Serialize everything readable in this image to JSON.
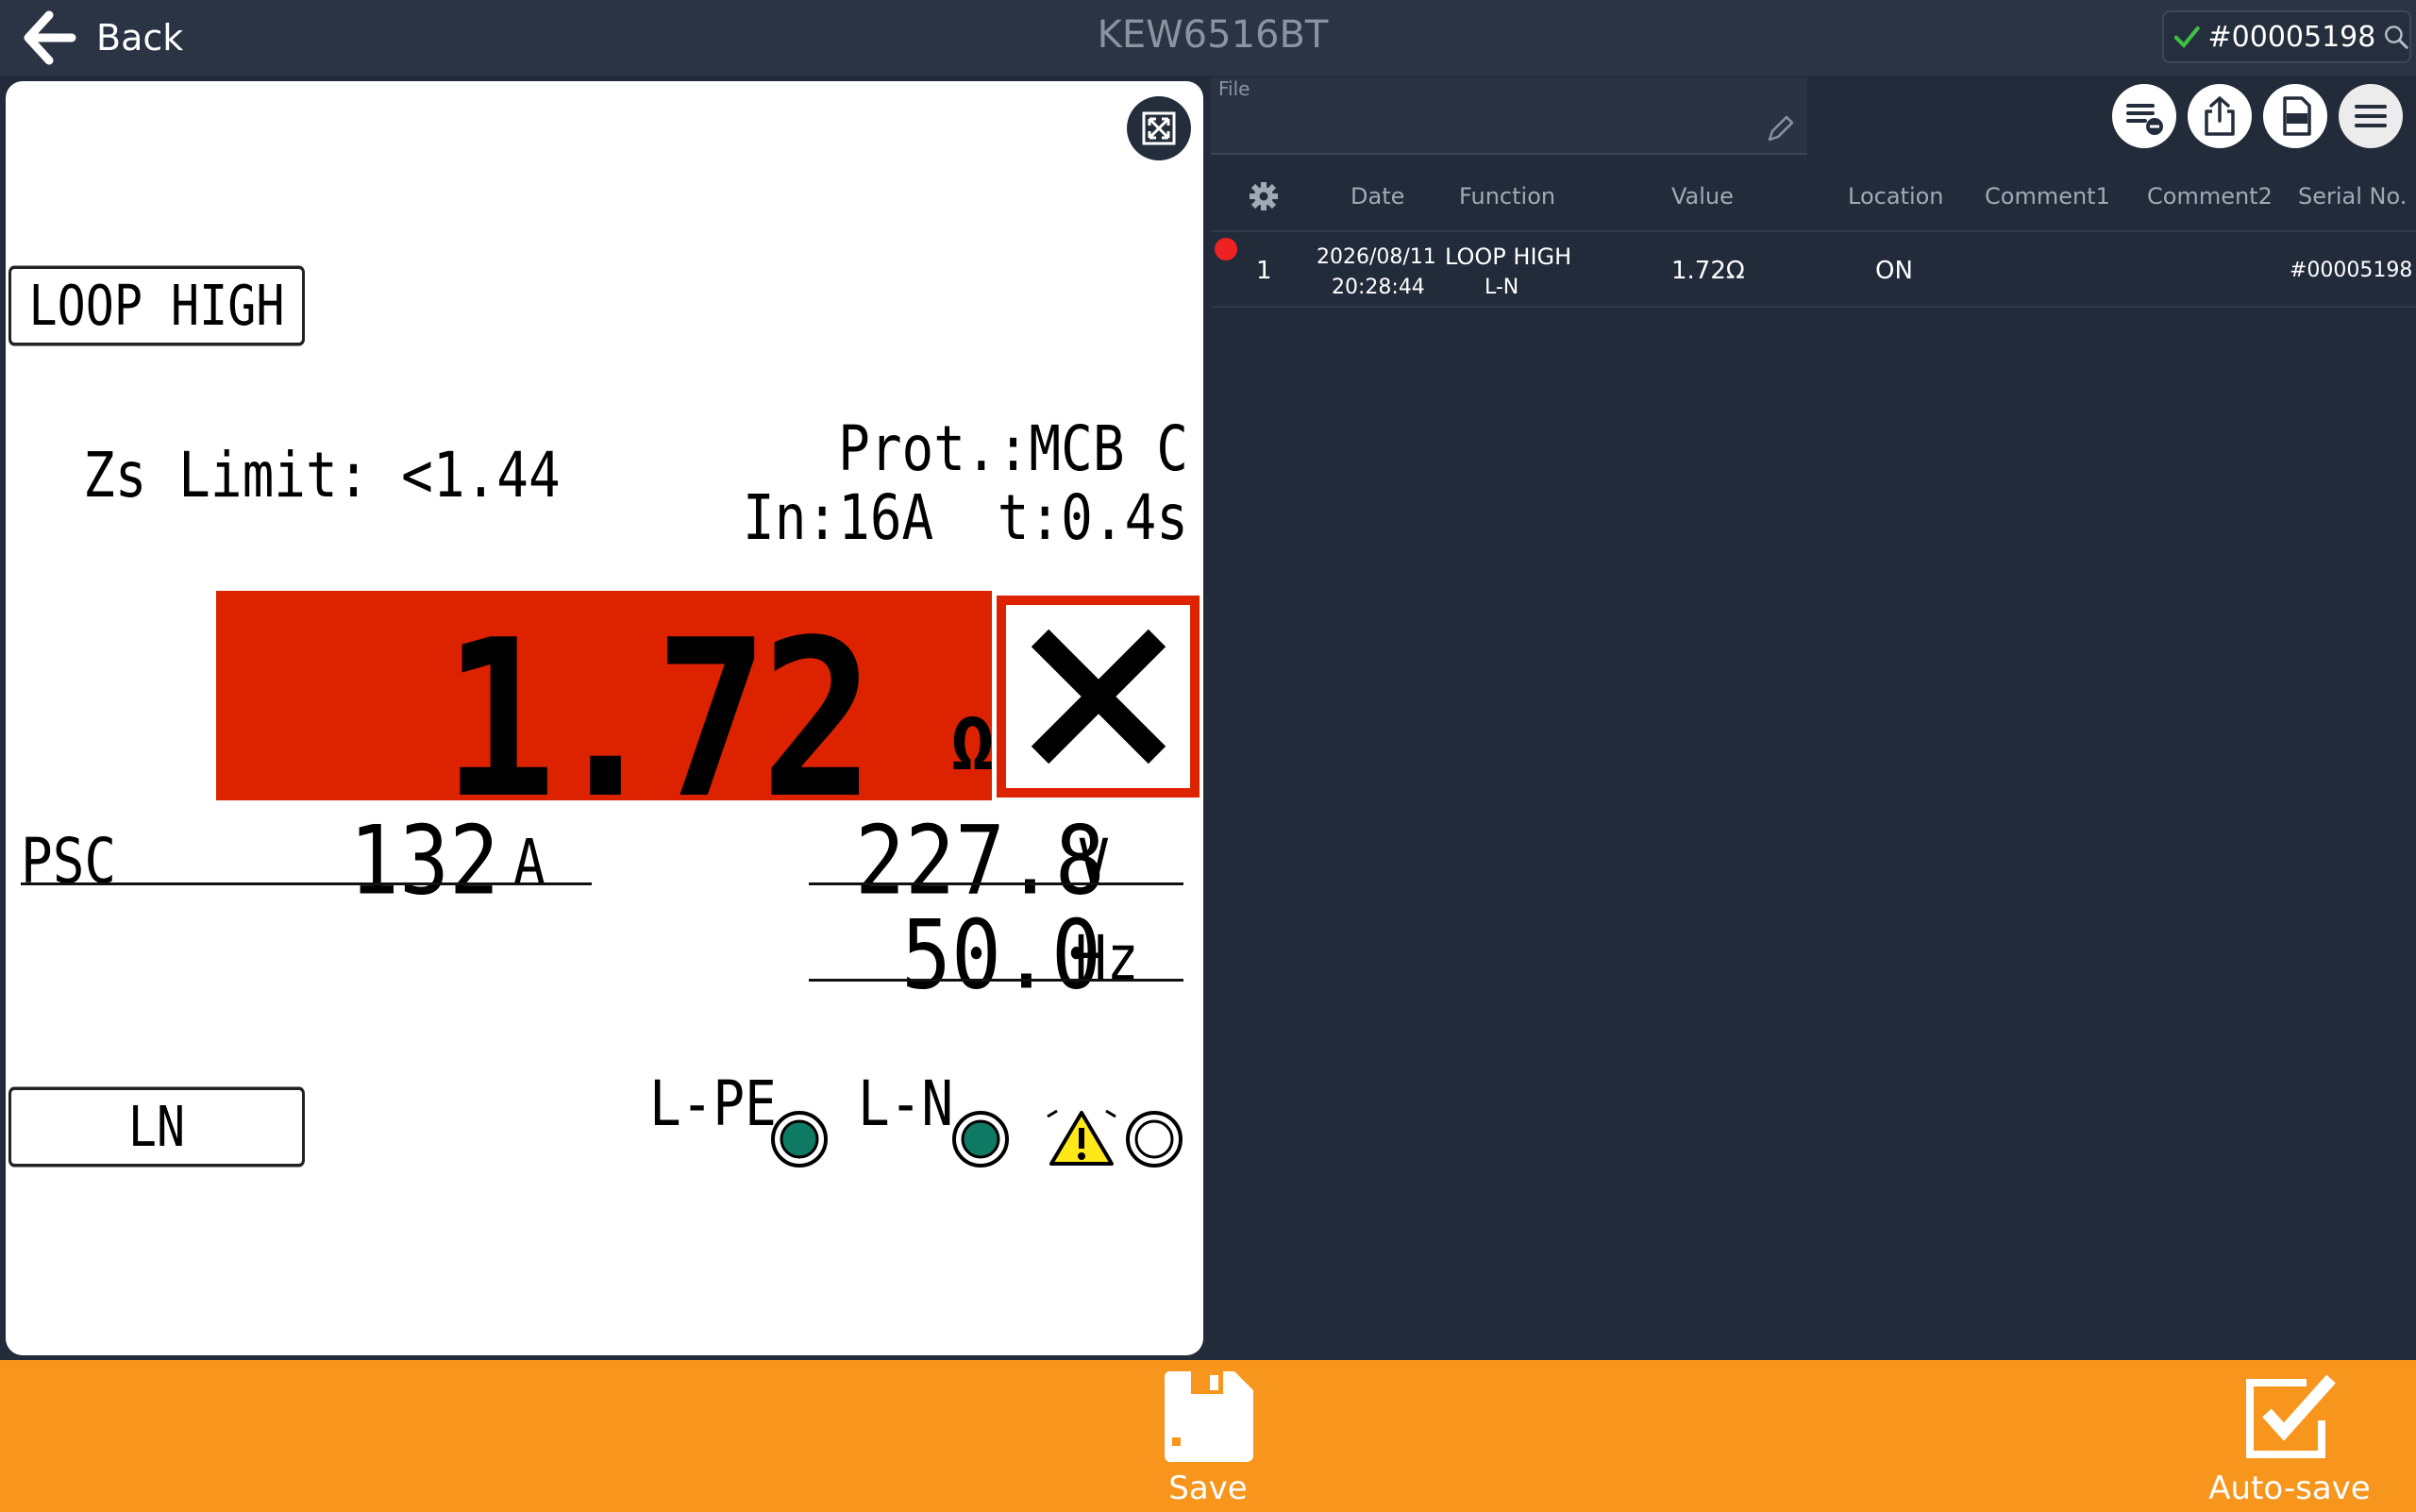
{
  "header": {
    "back_label": "Back",
    "title": "KEW6516BT",
    "serial": "#00005198"
  },
  "meter": {
    "function": "LOOP HIGH",
    "circuit": "LN",
    "zs_limit": "Zs Limit: <1.44",
    "prot_line1": "Prot.:MCB C",
    "prot_line2": "In:16A  t:0.4s",
    "reading_value": "1.72",
    "reading_unit": "Ω",
    "result": "fail",
    "psc_label": "PSC",
    "psc_value": "132",
    "psc_unit": "A",
    "voltage_value": "227.8",
    "voltage_unit": "V",
    "frequency_value": "50.0",
    "frequency_unit": "Hz",
    "indicator_lpe": "L-PE",
    "indicator_ln": "L-N",
    "colors": {
      "fail_red": "#dd2200",
      "led_green": "#0f7a63"
    }
  },
  "file": {
    "label": "File",
    "value": ""
  },
  "toolbar": {
    "icons": [
      "list-remove-icon",
      "share-icon",
      "xlsx-icon",
      "menu-icon"
    ]
  },
  "table": {
    "columns": [
      "Date",
      "Function",
      "Value",
      "Location",
      "Comment1",
      "Comment2",
      "Serial No."
    ],
    "rows": [
      {
        "no": "1",
        "date": "2026/08/11",
        "time": "20:28:44",
        "function": "LOOP HIGH",
        "function_sub": "L-N",
        "value": "1.72Ω",
        "location": "ON",
        "comment1": "",
        "comment2": "",
        "serial": "#00005198"
      }
    ]
  },
  "bottombar": {
    "save_label": "Save",
    "autosave_label": "Auto-save",
    "color": "#f7951d"
  }
}
